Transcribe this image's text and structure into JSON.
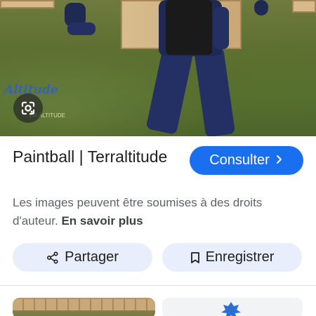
{
  "result": {
    "title": "Paintball | Terraltitude",
    "consult_label": "Consulter",
    "copyright_text": "Les images peuvent être soumises à des droits d'auteur.",
    "learn_more_label": "En savoir plus",
    "share_label": "Partager",
    "save_label": "Enregistrer"
  },
  "image": {
    "watermark_text": "Altitude",
    "watermark_sub": "EN ALTITUDE"
  },
  "icons": {
    "lens": "google-lens-icon",
    "chevron": "chevron-right-icon",
    "share": "share-icon",
    "bookmark": "bookmark-icon"
  },
  "colors": {
    "accent": "#1a6ff0",
    "chip_bg": "#e8eefb"
  }
}
